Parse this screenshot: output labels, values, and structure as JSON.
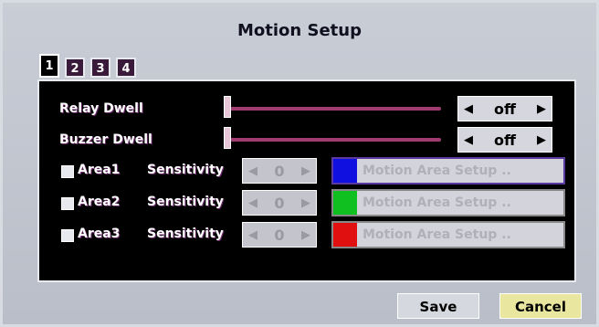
{
  "window": {
    "title": "Motion Setup"
  },
  "tabs": [
    "1",
    "2",
    "3",
    "4"
  ],
  "relay": {
    "label": "Relay Dwell",
    "value": "off",
    "level": 0
  },
  "buzzer": {
    "label": "Buzzer Dwell",
    "value": "off",
    "level": 0
  },
  "areas": [
    {
      "label": "Area1",
      "sensitivity_label": "Sensitivity",
      "sensitivity_value": "0",
      "setup_label": "Motion Area Setup ..",
      "color": "#1010e0",
      "checked": false
    },
    {
      "label": "Area2",
      "sensitivity_label": "Sensitivity",
      "sensitivity_value": "0",
      "setup_label": "Motion Area Setup ..",
      "color": "#10c020",
      "checked": false
    },
    {
      "label": "Area3",
      "sensitivity_label": "Sensitivity",
      "sensitivity_value": "0",
      "setup_label": "Motion Area Setup ..",
      "color": "#e01010",
      "checked": false
    }
  ],
  "footer": {
    "save_label": "Save",
    "cancel_label": "Cancel"
  }
}
